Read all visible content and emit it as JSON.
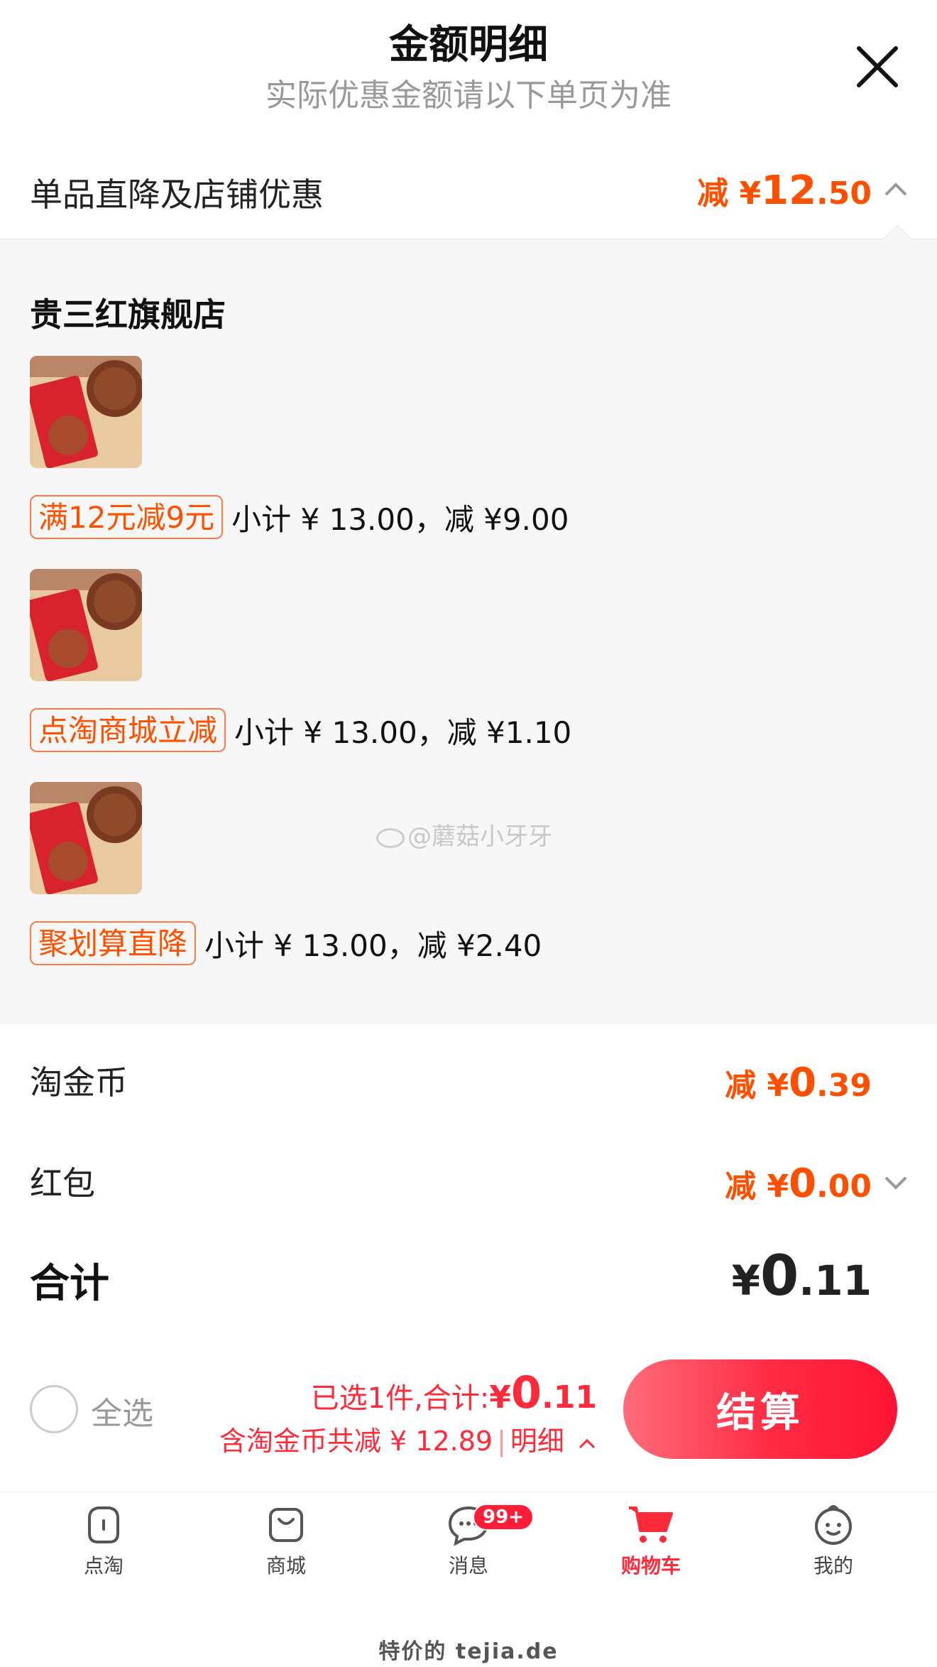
{
  "header": {
    "title": "金额明细",
    "subtitle": "实际优惠金额请以下单页为准",
    "close_icon": "close-icon"
  },
  "discount_section": {
    "label": "单品直降及店铺优惠",
    "value_prefix": "减 ¥",
    "value_int": "12",
    "value_dec": ".50",
    "expanded": true
  },
  "store": {
    "name": "贵三红旗舰店",
    "items": [
      {
        "tag": "满12元减9元",
        "subtotal": "小计 ¥ 13.00，减 ¥9.00"
      },
      {
        "tag": "点淘商城立减",
        "subtotal": "小计 ¥ 13.00，减 ¥1.10"
      },
      {
        "tag": "聚划算直降",
        "subtotal": "小计 ¥ 13.00，减 ¥2.40"
      }
    ]
  },
  "watermark": "@蘑菇小牙牙",
  "coins": {
    "label": "淘金币",
    "value_prefix": "减 ¥",
    "value_int": "0",
    "value_dec": ".39"
  },
  "redpacket": {
    "label": "红包",
    "value_prefix": "减 ¥",
    "value_int": "0",
    "value_dec": ".00"
  },
  "total": {
    "label": "合计",
    "currency": "¥",
    "value_int": "0",
    "value_dec": ".11"
  },
  "bottom_bar": {
    "select_all": "全选",
    "selected_text": "已选1件,合计:",
    "amount_currency": "¥",
    "amount_int": "0",
    "amount_dec": ".11",
    "savings_text": "含淘金币共减 ¥ 12.89",
    "details_link": "明细",
    "checkout_label": "结算"
  },
  "tabs": [
    {
      "label": "点淘",
      "icon": "diantao-icon",
      "active": false
    },
    {
      "label": "商城",
      "icon": "mall-bag-icon",
      "active": false
    },
    {
      "label": "消息",
      "icon": "message-icon",
      "active": false,
      "badge": "99+"
    },
    {
      "label": "购物车",
      "icon": "cart-icon",
      "active": true
    },
    {
      "label": "我的",
      "icon": "profile-icon",
      "active": false
    }
  ],
  "footer_watermark": "特价的 tejia.de",
  "colors": {
    "accent": "#ff5000",
    "checkout": "#ff2a43",
    "muted": "#999999"
  }
}
